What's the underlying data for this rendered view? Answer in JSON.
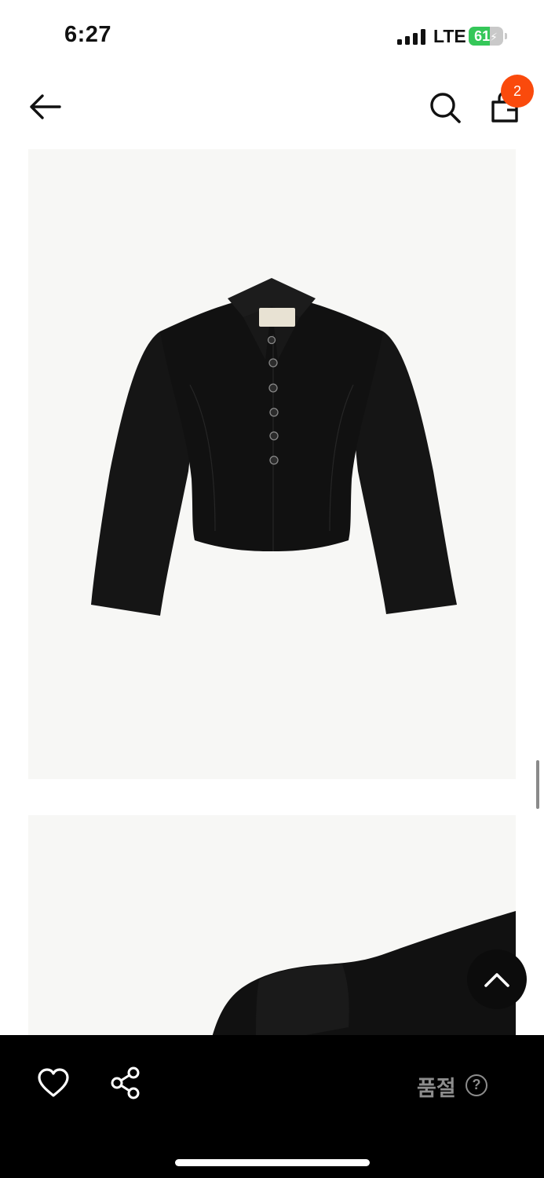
{
  "status_bar": {
    "time": "6:27",
    "network": "LTE",
    "battery_percent": 61,
    "battery_label": "61",
    "battery_charging": true,
    "signal_bars": 4
  },
  "header": {
    "back_icon": "arrow-left-icon",
    "search_icon": "search-icon",
    "bag_icon": "shopping-bag-icon",
    "cart_count": "2"
  },
  "product_images": [
    {
      "subject": "black cropped collared jacket, front view",
      "icon": "product-image"
    },
    {
      "subject": "black jacket, shoulder close-up",
      "icon": "product-image"
    }
  ],
  "bottom_bar": {
    "like_icon": "heart-icon",
    "share_icon": "share-icon",
    "status_label": "품절",
    "help_label": "?"
  },
  "colors": {
    "badge": "#fa4a0c",
    "battery_fill": "#35c759",
    "bottom_bar": "#000000",
    "image_bg": "#f7f7f5",
    "soldout_text": "#8d8d8d"
  }
}
